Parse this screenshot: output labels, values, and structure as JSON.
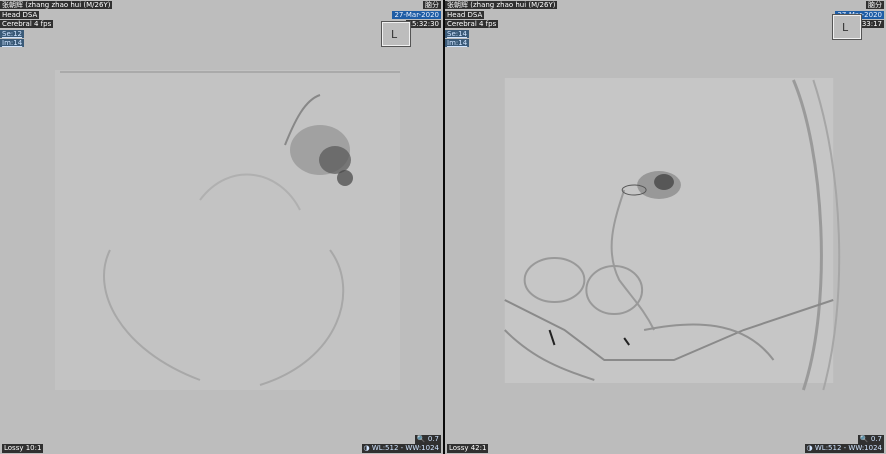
{
  "left": {
    "patient": "张朝辉 (zhang zhao hui (M/26Y)",
    "corner_tag": "脑分",
    "study": "Head DSA",
    "protocol": "Cerebral 4 fps",
    "series": "Se:12",
    "image": "Im:14",
    "date": "27-Mar-2020",
    "time": "15:32:30",
    "orientation": "L",
    "zoom": "0.7",
    "compression": "Lossy 10:1",
    "window": "WL:512 - WW:1024"
  },
  "right": {
    "patient": "张朝辉 (zhang zhao hui (M/26Y)",
    "corner_tag": "脑分",
    "study": "Head DSA",
    "protocol": "Cerebral 4 fps",
    "series": "Se:14",
    "image": "Im:14",
    "date": "27-Mar-2020",
    "time": "15:33:17",
    "orientation": "L",
    "zoom": "0.7",
    "compression": "Lossy 42:1",
    "window": "WL:512 - WW:1024"
  },
  "colors": {
    "viewport_bg": "#bdbdbd",
    "overlay_label_bg": "#303030",
    "date_badge_bg": "#1f5da5"
  },
  "icons": {
    "zoom": "magnifier-icon",
    "window_level": "contrast-icon"
  }
}
